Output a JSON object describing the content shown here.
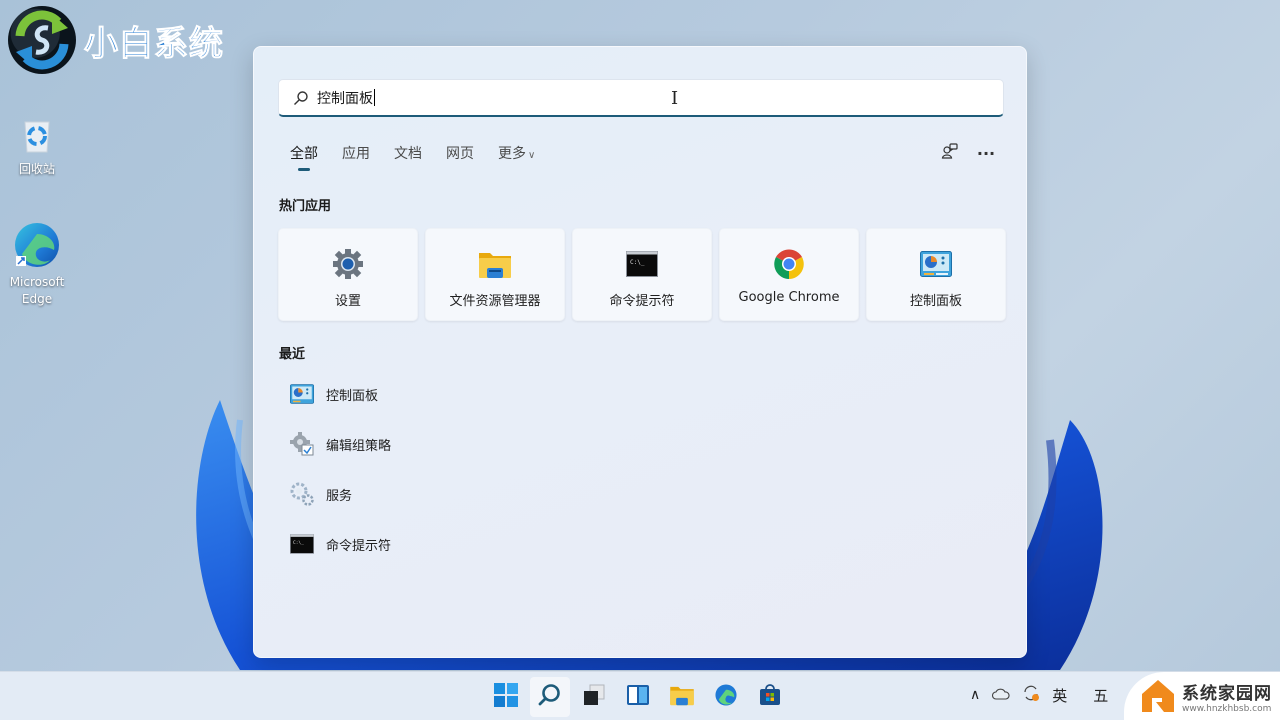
{
  "watermark_logo": {
    "text": "小白系统"
  },
  "desktop": {
    "icons": [
      {
        "label": "回收站"
      },
      {
        "label": "Microsoft Edge"
      }
    ]
  },
  "search": {
    "value": "控制面板",
    "placeholder": ""
  },
  "tabs": [
    {
      "label": "全部",
      "active": true
    },
    {
      "label": "应用",
      "active": false
    },
    {
      "label": "文档",
      "active": false
    },
    {
      "label": "网页",
      "active": false
    },
    {
      "label": "更多",
      "active": false,
      "has_dropdown": true
    }
  ],
  "toolbar": {
    "account_icon": "account-switch-icon",
    "more_label": "···"
  },
  "top_apps": {
    "title": "热门应用",
    "items": [
      {
        "label": "设置",
        "icon": "settings-gear-icon"
      },
      {
        "label": "文件资源管理器",
        "icon": "file-explorer-icon"
      },
      {
        "label": "命令提示符",
        "icon": "command-prompt-icon"
      },
      {
        "label": "Google Chrome",
        "icon": "chrome-icon"
      },
      {
        "label": "控制面板",
        "icon": "control-panel-icon"
      }
    ]
  },
  "recent": {
    "title": "最近",
    "items": [
      {
        "label": "控制面板",
        "icon": "control-panel-icon"
      },
      {
        "label": "编辑组策略",
        "icon": "group-policy-icon"
      },
      {
        "label": "服务",
        "icon": "services-icon"
      },
      {
        "label": "命令提示符",
        "icon": "command-prompt-icon"
      }
    ]
  },
  "cmd_prompt_text": "C:\\_",
  "taskbar": {
    "apps": [
      {
        "name": "start",
        "icon": "windows-start-icon"
      },
      {
        "name": "search",
        "icon": "search-icon",
        "active": true
      },
      {
        "name": "task-view",
        "icon": "task-view-icon"
      },
      {
        "name": "widgets",
        "icon": "widgets-icon"
      },
      {
        "name": "file-explorer",
        "icon": "file-explorer-icon"
      },
      {
        "name": "edge",
        "icon": "edge-icon"
      },
      {
        "name": "store",
        "icon": "store-icon"
      }
    ],
    "tray": {
      "chevron": "^",
      "ime_lang": "英",
      "ime_mode": "五"
    }
  },
  "site_watermark": {
    "title": "系统家园网",
    "url": "www.hnzkhbsb.com"
  },
  "colors": {
    "accent": "#1d5b79",
    "panel_bg": "#e8eef8",
    "tile_bg": "#f5f8fc",
    "taskbar_bg": "#e3ebf5",
    "logo_blue": "#2a7fd4",
    "watermark_orange": "#f08a1c"
  }
}
